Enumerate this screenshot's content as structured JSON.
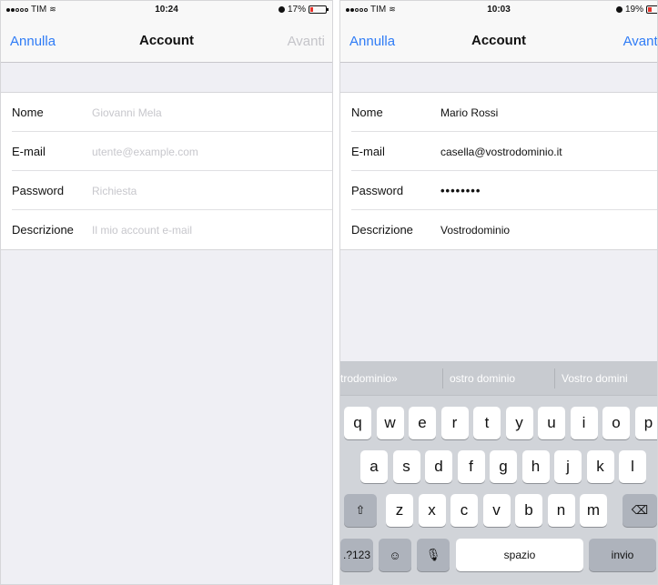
{
  "left": {
    "status": {
      "carrier": "TIM",
      "time": "10:24",
      "battery": "17%"
    },
    "nav": {
      "cancel": "Annulla",
      "title": "Account",
      "next": "Avanti"
    },
    "fields": [
      {
        "label": "Nome",
        "placeholder": "Giovanni Mela"
      },
      {
        "label": "E-mail",
        "placeholder": "utente@example.com"
      },
      {
        "label": "Password",
        "placeholder": "Richiesta"
      },
      {
        "label": "Descrizione",
        "placeholder": "Il mio account e-mail"
      }
    ]
  },
  "right": {
    "status": {
      "carrier": "TIM",
      "time": "10:03",
      "battery": "19%"
    },
    "nav": {
      "cancel": "Annulla",
      "title": "Account",
      "next": "Avanti"
    },
    "fields": [
      {
        "label": "Nome",
        "value": "Mario Rossi"
      },
      {
        "label": "E-mail",
        "value": "casella@vostrodominio.it"
      },
      {
        "label": "Password",
        "value": "••••••••"
      },
      {
        "label": "Descrizione",
        "value": "Vostrodominio"
      }
    ],
    "keyboard": {
      "suggestions": [
        "trodominio»",
        "ostro dominio",
        "Vostro domini"
      ],
      "row1": [
        "q",
        "w",
        "e",
        "r",
        "t",
        "y",
        "u",
        "i",
        "o",
        "p"
      ],
      "row2": [
        "a",
        "s",
        "d",
        "f",
        "g",
        "h",
        "j",
        "k",
        "l"
      ],
      "row3": [
        "z",
        "x",
        "c",
        "v",
        "b",
        "n",
        "m"
      ],
      "shift_icon": "⇧",
      "delete_icon": "⌫",
      "numbers": ".?123",
      "emoji_icon": "☺",
      "mic_icon": "🎙",
      "space": "spazio",
      "return": "invio"
    }
  },
  "colors": {
    "accent": "#2f7cf6",
    "battery_low": "#e8322b"
  }
}
